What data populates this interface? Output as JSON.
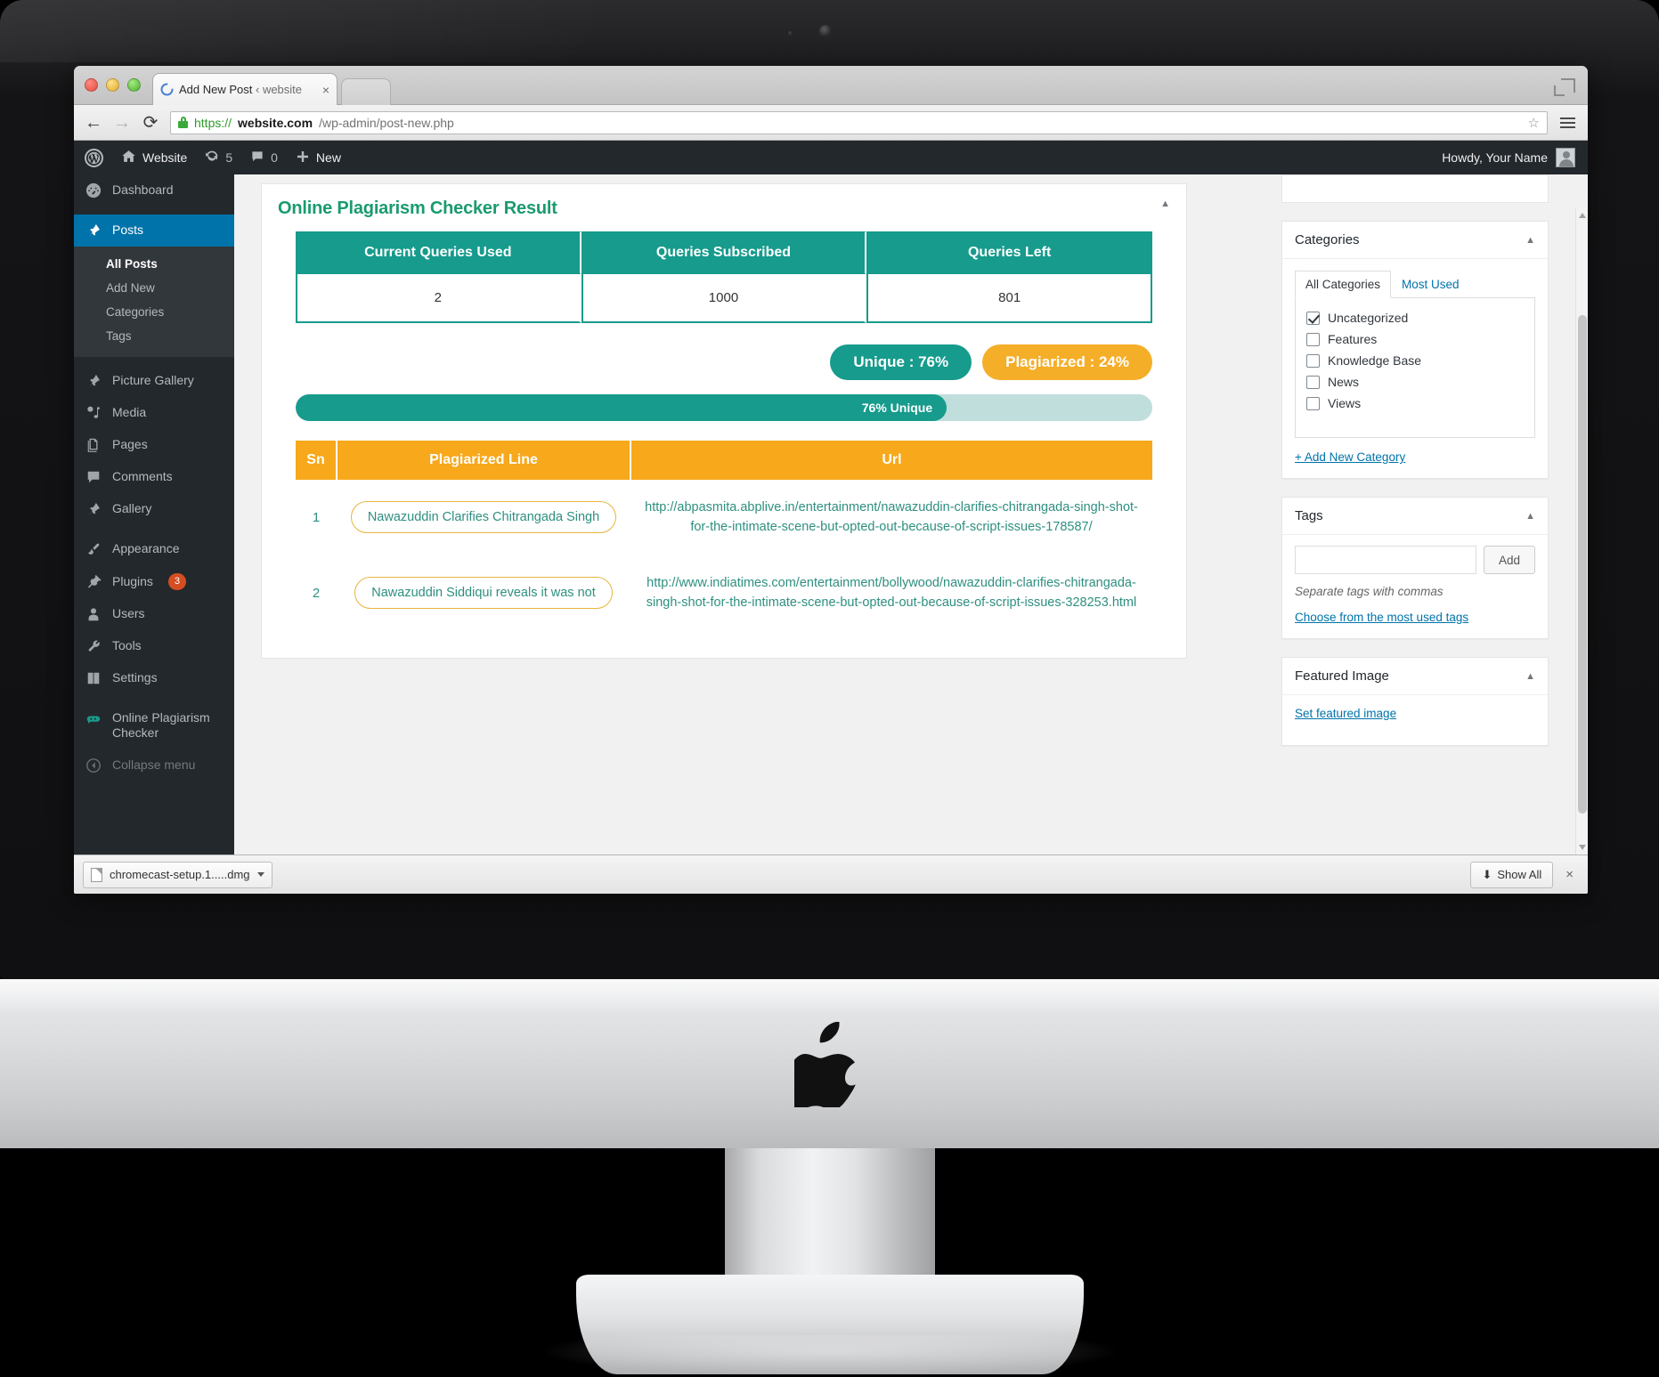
{
  "browser": {
    "tab": {
      "title": "Add New Post",
      "suffix": "‹ website",
      "close_label": "×",
      "favicon": "wordpress-spinner-icon"
    },
    "nav": {
      "back": "←",
      "forward": "→",
      "reload": "⟳"
    },
    "url": {
      "scheme": "https://",
      "host": "website.com",
      "path": "/wp-admin/post-new.php",
      "lock": "lock-icon"
    },
    "star": "☆",
    "menu": "hamburger-menu-icon"
  },
  "adminbar": {
    "logo": "W",
    "site_name": "Website",
    "updates_count": "5",
    "comments_count": "0",
    "new_label": "New",
    "howdy": "Howdy, Your Name"
  },
  "sidebar": {
    "items": [
      {
        "label": "Dashboard",
        "icon": "dashboard-icon",
        "current": false
      },
      {
        "label": "Posts",
        "icon": "pin-icon",
        "current": true
      },
      {
        "label": "Picture Gallery",
        "icon": "pin-icon",
        "current": false
      },
      {
        "label": "Media",
        "icon": "media-icon",
        "current": false
      },
      {
        "label": "Pages",
        "icon": "pages-icon",
        "current": false
      },
      {
        "label": "Comments",
        "icon": "comment-icon",
        "current": false
      },
      {
        "label": "Gallery",
        "icon": "pin-icon",
        "current": false
      },
      {
        "label": "Appearance",
        "icon": "brush-icon",
        "current": false
      },
      {
        "label": "Plugins",
        "icon": "plug-icon",
        "current": false,
        "badge": "3"
      },
      {
        "label": "Users",
        "icon": "user-icon",
        "current": false
      },
      {
        "label": "Tools",
        "icon": "wrench-icon",
        "current": false
      },
      {
        "label": "Settings",
        "icon": "settings-icon",
        "current": false
      },
      {
        "label": "Online Plagiarism Checker",
        "icon": "plagiarism-icon",
        "current": false
      }
    ],
    "posts_submenu": [
      {
        "label": "All Posts",
        "current": true
      },
      {
        "label": "Add New",
        "current": false
      },
      {
        "label": "Categories",
        "current": false
      },
      {
        "label": "Tags",
        "current": false
      }
    ],
    "collapse_label": "Collapse menu"
  },
  "result_panel": {
    "title": "Online Plagiarism Checker Result",
    "toggle": "▲",
    "queries_table": {
      "headers": [
        "Current Queries Used",
        "Queries Subscribed",
        "Queries Left"
      ],
      "values": [
        "2",
        "1000",
        "801"
      ]
    },
    "unique_badge": "Unique : 76%",
    "plagiarized_badge": "Plagiarized : 24%",
    "progress": {
      "label": "76% Unique",
      "percent": 76
    },
    "results_table": {
      "headers": [
        "Sn",
        "Plagiarized Line",
        "Url"
      ],
      "rows": [
        {
          "sn": "1",
          "line": "Nawazuddin Clarifies Chitrangada Singh",
          "url": "http://abpasmita.abplive.in/entertainment/nawazuddin-clarifies-chitrangada-singh-shot-for-the-intimate-scene-but-opted-out-because-of-script-issues-178587/"
        },
        {
          "sn": "2",
          "line": "Nawazuddin Siddiqui reveals it was not",
          "url": "http://www.indiatimes.com/entertainment/bollywood/nawazuddin-clarifies-chitrangada-singh-shot-for-the-intimate-scene-but-opted-out-because-of-script-issues-328253.html"
        }
      ]
    }
  },
  "categories_box": {
    "title": "Categories",
    "toggle": "▲",
    "tabs": [
      {
        "label": "All Categories",
        "active": true
      },
      {
        "label": "Most Used",
        "active": false
      }
    ],
    "items": [
      {
        "label": "Uncategorized",
        "checked": true
      },
      {
        "label": "Features",
        "checked": false
      },
      {
        "label": "Knowledge Base",
        "checked": false
      },
      {
        "label": "News",
        "checked": false
      },
      {
        "label": "Views",
        "checked": false
      }
    ],
    "add_link": "+ Add New Category"
  },
  "tags_box": {
    "title": "Tags",
    "toggle": "▲",
    "input_value": "",
    "input_placeholder": "",
    "add_button": "Add",
    "hint": "Separate tags with commas",
    "most_used_link": "Choose from the most used tags"
  },
  "featured_image_box": {
    "title": "Featured Image",
    "toggle": "▲",
    "set_link": "Set featured image"
  },
  "downloadbar": {
    "file_name": "chromecast-setup.1.....dmg",
    "caret": "▾",
    "show_all": "Show All",
    "download_arrow": "⬇",
    "close": "×"
  },
  "colors": {
    "teal": "#169b8c",
    "teal_dark": "#1a9b6e",
    "orange": "#f7a81b",
    "orange_light": "#f5ae28",
    "wp_blue": "#0073aa",
    "wp_dark": "#23282d",
    "badge_red": "#d54e21"
  }
}
